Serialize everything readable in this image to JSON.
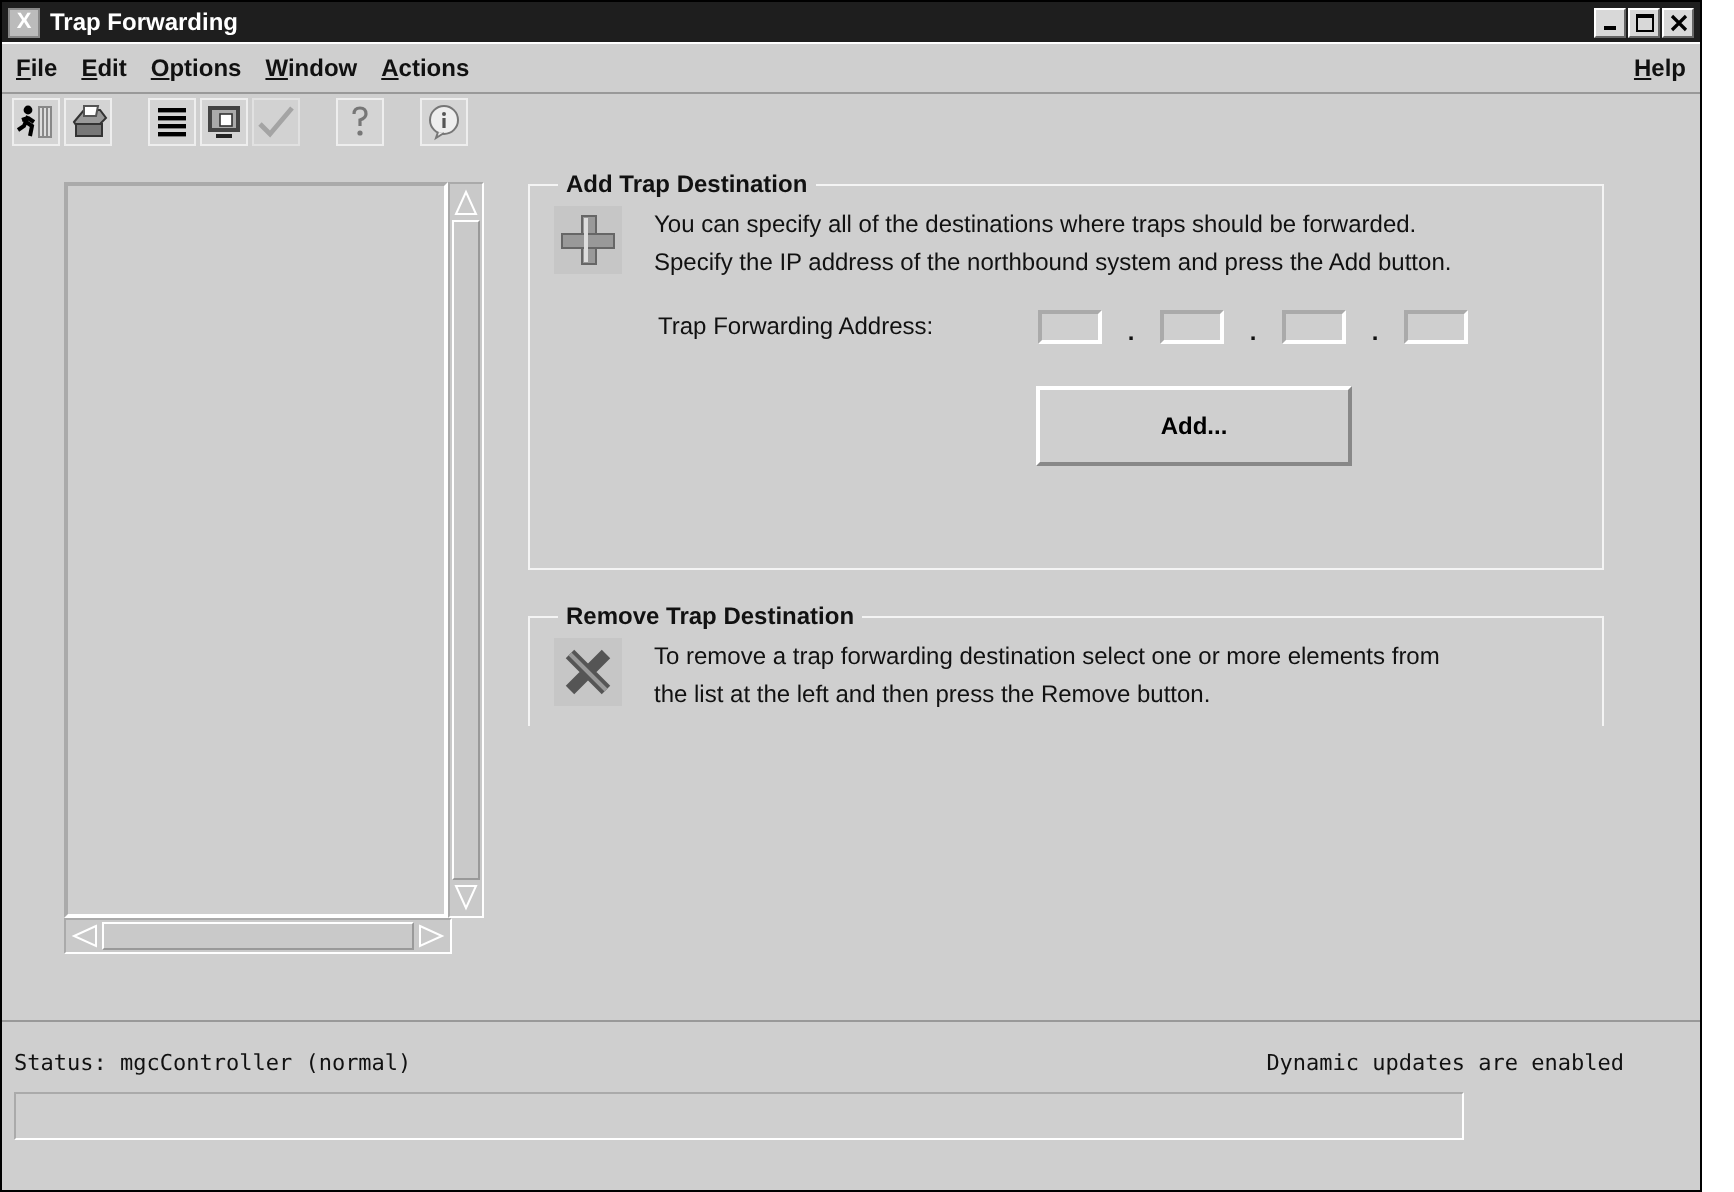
{
  "window": {
    "title": "Trap Forwarding",
    "title_icon": "X"
  },
  "menu": {
    "left": [
      {
        "label": "File"
      },
      {
        "label": "Edit"
      },
      {
        "label": "Options"
      },
      {
        "label": "Window"
      },
      {
        "label": "Actions"
      }
    ],
    "right": [
      {
        "label": "Help"
      }
    ]
  },
  "toolbar": [
    {
      "kind": "runner",
      "disabled": false
    },
    {
      "kind": "printer",
      "disabled": false
    },
    {
      "kind": "list",
      "disabled": false
    },
    {
      "kind": "monitor",
      "disabled": false
    },
    {
      "kind": "check",
      "disabled": true
    },
    {
      "kind": "help",
      "disabled": false
    },
    {
      "kind": "info",
      "disabled": false
    }
  ],
  "add_section": {
    "title": "Add Trap Destination",
    "description": "You can specify all of the destinations where traps should be forwarded.\nSpecify the IP address of the northbound system and press the Add button.",
    "address_label": "Trap Forwarding Address:",
    "separators": [
      ".",
      ".",
      "."
    ],
    "button": "Add..."
  },
  "remove_section": {
    "title": "Remove Trap Destination",
    "description": "To remove a trap forwarding destination select one or more elements from\nthe list at the left and then press the Remove button."
  },
  "status_bar": {
    "status": "Status: mgcController (normal)",
    "updates": "Dynamic updates are enabled"
  }
}
